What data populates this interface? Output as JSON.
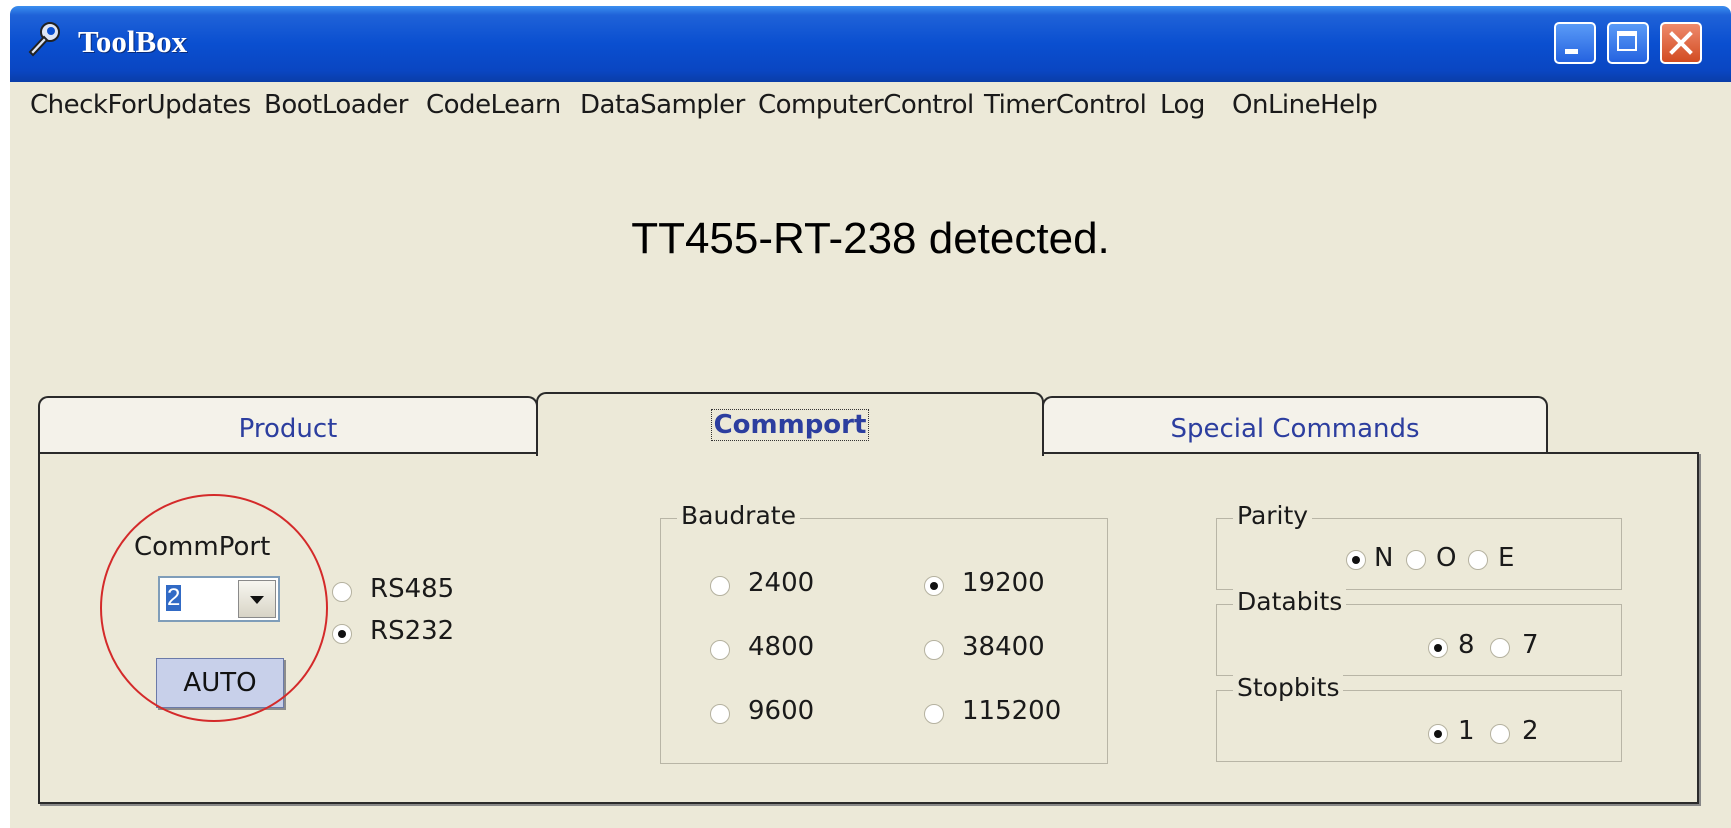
{
  "window": {
    "title": "ToolBox"
  },
  "menu": [
    "CheckForUpdates",
    "BootLoader",
    "CodeLearn",
    "DataSampler",
    "ComputerControl",
    "TimerControl",
    "Log",
    "OnLineHelp"
  ],
  "status": "TT455-RT-238 detected.",
  "tabs": [
    "Product",
    "Commport",
    "Special Commands"
  ],
  "active_tab": "Commport",
  "commport": {
    "label": "CommPort",
    "value": "2",
    "auto_label": "AUTO",
    "interfaces": [
      {
        "label": "RS485",
        "checked": false
      },
      {
        "label": "RS232",
        "checked": true
      }
    ]
  },
  "baudrate": {
    "legend": "Baudrate",
    "options": [
      {
        "label": "2400",
        "checked": false
      },
      {
        "label": "19200",
        "checked": true
      },
      {
        "label": "4800",
        "checked": false
      },
      {
        "label": "38400",
        "checked": false
      },
      {
        "label": "9600",
        "checked": false
      },
      {
        "label": "115200",
        "checked": false
      }
    ]
  },
  "parity": {
    "legend": "Parity",
    "options": [
      {
        "label": "N",
        "checked": true
      },
      {
        "label": "O",
        "checked": false
      },
      {
        "label": "E",
        "checked": false
      }
    ]
  },
  "databits": {
    "legend": "Databits",
    "options": [
      {
        "label": "8",
        "checked": true
      },
      {
        "label": "7",
        "checked": false
      }
    ]
  },
  "stopbits": {
    "legend": "Stopbits",
    "options": [
      {
        "label": "1",
        "checked": true
      },
      {
        "label": "2",
        "checked": false
      }
    ]
  },
  "colors": {
    "title_bar": "#0A4FD0",
    "window_bg": "#ECE9D8",
    "tab_text": "#2C3E9F",
    "highlight_circle": "#D42A2A",
    "auto_button": "#C8D0EA"
  }
}
